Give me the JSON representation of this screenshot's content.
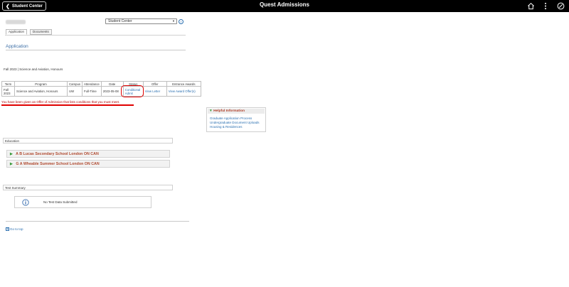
{
  "header": {
    "back_label": "Student Center",
    "title": "Quest Admissions",
    "icons": [
      "home-icon",
      "more-vertical-icon",
      "navbar-icon"
    ]
  },
  "nav": {
    "selected": "Student Center",
    "go_label": "»"
  },
  "tabs": [
    {
      "label": "Application"
    },
    {
      "label": "Documents"
    }
  ],
  "page_title": "Application",
  "term_text": "Fall 2023 | Science and Aviation, Honours",
  "table": {
    "headers": [
      "Term",
      "Program",
      "Campus",
      "Attendance",
      "Date",
      "Status",
      "Offer",
      "Entrance Awards"
    ],
    "row": {
      "term": "Fall 2023",
      "program": "Science and Aviation, Honours",
      "campus": "UW",
      "attendance": "Full-Time",
      "date": "2023-05-08",
      "status": "Conditional Admit",
      "offer": "View Letter",
      "awards": "View Award Offer(s)"
    }
  },
  "offer_message": "You have been given an Offer of Admission that lists conditions that you must meet.",
  "helpful": {
    "title": "Helpful Information",
    "links": [
      "Graduate Application Process",
      "Undergraduate Document Uploads",
      "Housing & Residences"
    ]
  },
  "education": {
    "title": "Education",
    "schools": [
      "A B Lucas Secondary School London ON CAN",
      "G A Wheable Summer School London ON CAN"
    ]
  },
  "test_summary": {
    "title": "Test Summary",
    "message": "No Test Data Submitted"
  },
  "go_top_label": "Go to top",
  "colors": {
    "accent": "#2a6fb0",
    "annotation": "#e00000",
    "topbar": "#000000"
  }
}
